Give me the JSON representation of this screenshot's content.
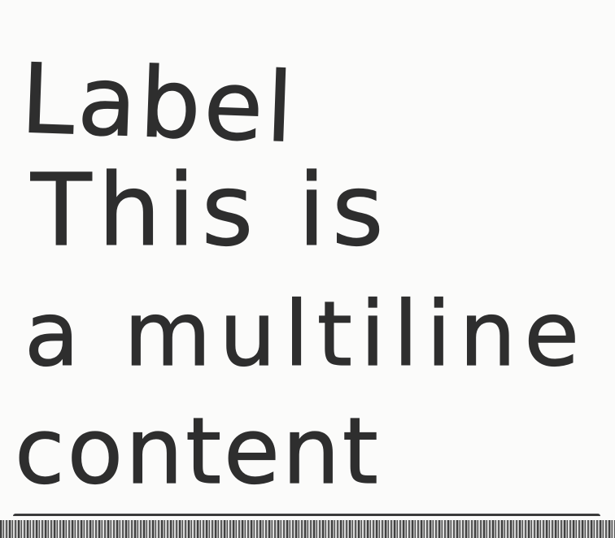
{
  "note": {
    "label": "Label",
    "content_lines": [
      "This is",
      "a multiline",
      "content"
    ]
  },
  "colors": {
    "ink": "#2e2e2e",
    "paper": "#fbfbfa"
  }
}
